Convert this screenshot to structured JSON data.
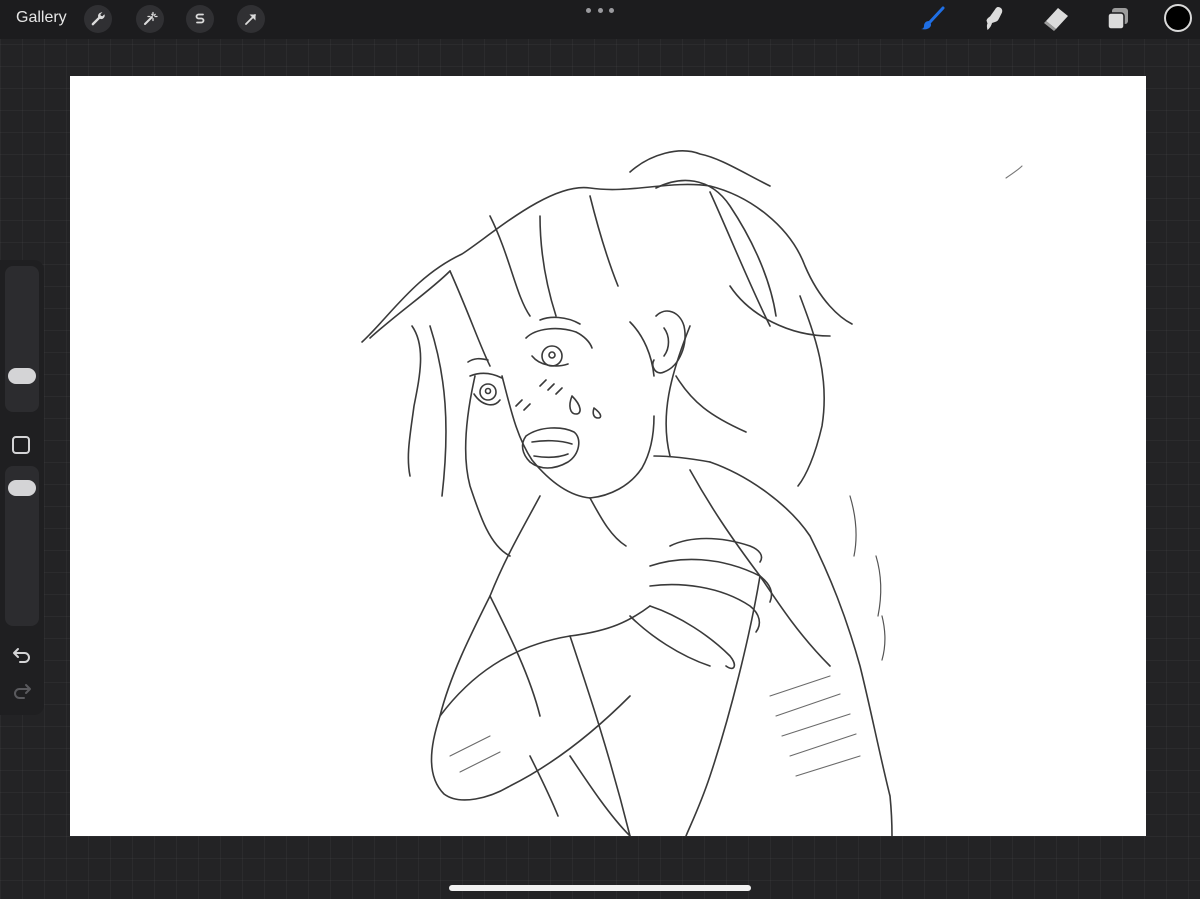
{
  "topbar": {
    "gallery_label": "Gallery",
    "left_tools": [
      "wrench-icon",
      "magic-wand-icon",
      "selection-s-icon",
      "transform-arrow-icon"
    ],
    "right_tools": [
      "brush-icon",
      "smudge-icon",
      "eraser-icon",
      "layers-icon"
    ],
    "active_tool": "brush-icon",
    "active_color": "#1f6fe5",
    "current_color": "#000000"
  },
  "sidebar": {
    "tools": [
      "brush-size-slider",
      "modify-button",
      "opacity-slider",
      "undo-icon",
      "redo-icon"
    ]
  },
  "canvas": {
    "background": "#ffffff",
    "content": "pencil-sketch"
  }
}
